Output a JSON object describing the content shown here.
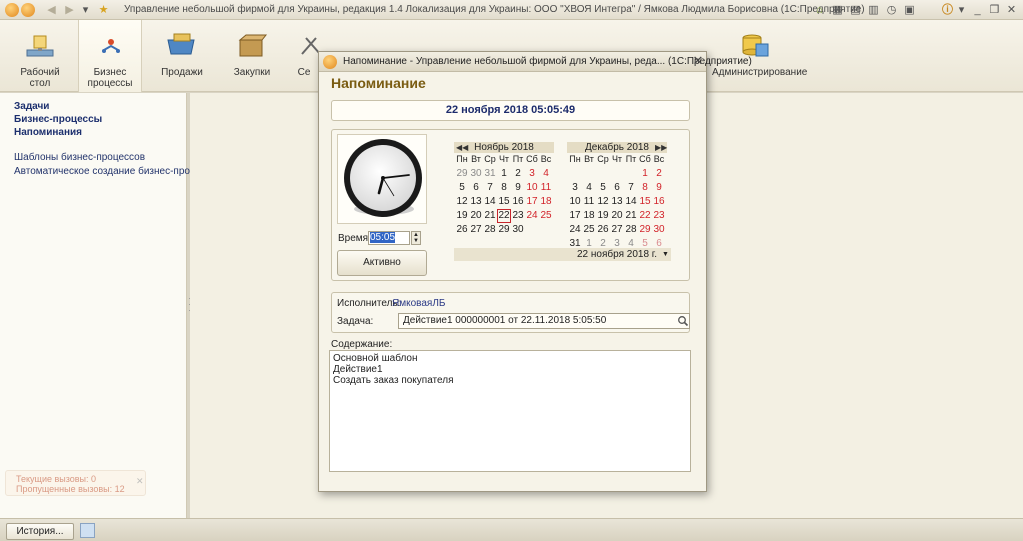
{
  "app": {
    "title": "Управление небольшой фирмой для Украины, редакция 1.4 Локализация для Украины: ООО \"ХВОЯ Интегра\" / Ямкова Людмила Борисовна  (1С:Предприятие)"
  },
  "sections": [
    {
      "label": "Рабочий стол",
      "icon": "desktop-icon"
    },
    {
      "label": "Бизнес процессы",
      "icon": "business-process-icon",
      "active": true
    },
    {
      "label": "Продажи",
      "icon": "sales-icon"
    },
    {
      "label": "Закупки",
      "icon": "purchases-icon"
    },
    {
      "label": "Се",
      "icon": "service-icon"
    },
    {
      "label": "Администрирование",
      "icon": "admin-icon"
    }
  ],
  "sidebar": {
    "nav": [
      "Задачи",
      "Бизнес-процессы",
      "Напоминания"
    ],
    "links": [
      "Шаблоны бизнес-процессов",
      "Автоматическое создание бизнес-процес..."
    ]
  },
  "notification": {
    "line1": "Текущие вызовы: 0",
    "line2": "Пропущенные вызовы: 12"
  },
  "statusbar": {
    "history_label": "История..."
  },
  "dialog": {
    "title": "Напоминание - Управление небольшой фирмой для Украины, реда...  (1С:Предприятие)",
    "heading": "Напоминание",
    "datetime": "22 ноября 2018   05:05:49",
    "time_label": "Время:",
    "time_value": "05:05",
    "active_button": "Активно",
    "executor_label": "Исполнитель:",
    "executor_value": "ЯмковаяЛБ",
    "task_label": "Задача:",
    "task_value": "Действие1 000000001 от 22.11.2018 5:05:50",
    "content_label": "Содержание:",
    "content_lines": [
      "Основной шаблон",
      "Действие1",
      "Создать заказ покупателя"
    ],
    "calendar": {
      "weekdays": [
        "Пн",
        "Вт",
        "Ср",
        "Чт",
        "Пт",
        "Сб",
        "Вс"
      ],
      "months": [
        {
          "name": "Ноябрь 2018",
          "weeks": [
            [
              "29",
              "30",
              "31",
              "1",
              "2",
              "3",
              "4"
            ],
            [
              "5",
              "6",
              "7",
              "8",
              "9",
              "10",
              "11"
            ],
            [
              "12",
              "13",
              "14",
              "15",
              "16",
              "17",
              "18"
            ],
            [
              "19",
              "20",
              "21",
              "22",
              "23",
              "24",
              "25"
            ],
            [
              "26",
              "27",
              "28",
              "29",
              "30",
              "",
              ""
            ]
          ],
          "leading_other_month": 3,
          "selected": "22"
        },
        {
          "name": "Декабрь 2018",
          "weeks": [
            [
              "",
              "",
              "",
              "",
              "",
              "1",
              "2"
            ],
            [
              "3",
              "4",
              "5",
              "6",
              "7",
              "8",
              "9"
            ],
            [
              "10",
              "11",
              "12",
              "13",
              "14",
              "15",
              "16"
            ],
            [
              "17",
              "18",
              "19",
              "20",
              "21",
              "22",
              "23"
            ],
            [
              "24",
              "25",
              "26",
              "27",
              "28",
              "29",
              "30"
            ],
            [
              "31",
              "1",
              "2",
              "3",
              "4",
              "5",
              "6"
            ]
          ],
          "trailing_other_month_from_week": 5
        }
      ],
      "selected_label": "22 ноября 2018 г."
    }
  }
}
